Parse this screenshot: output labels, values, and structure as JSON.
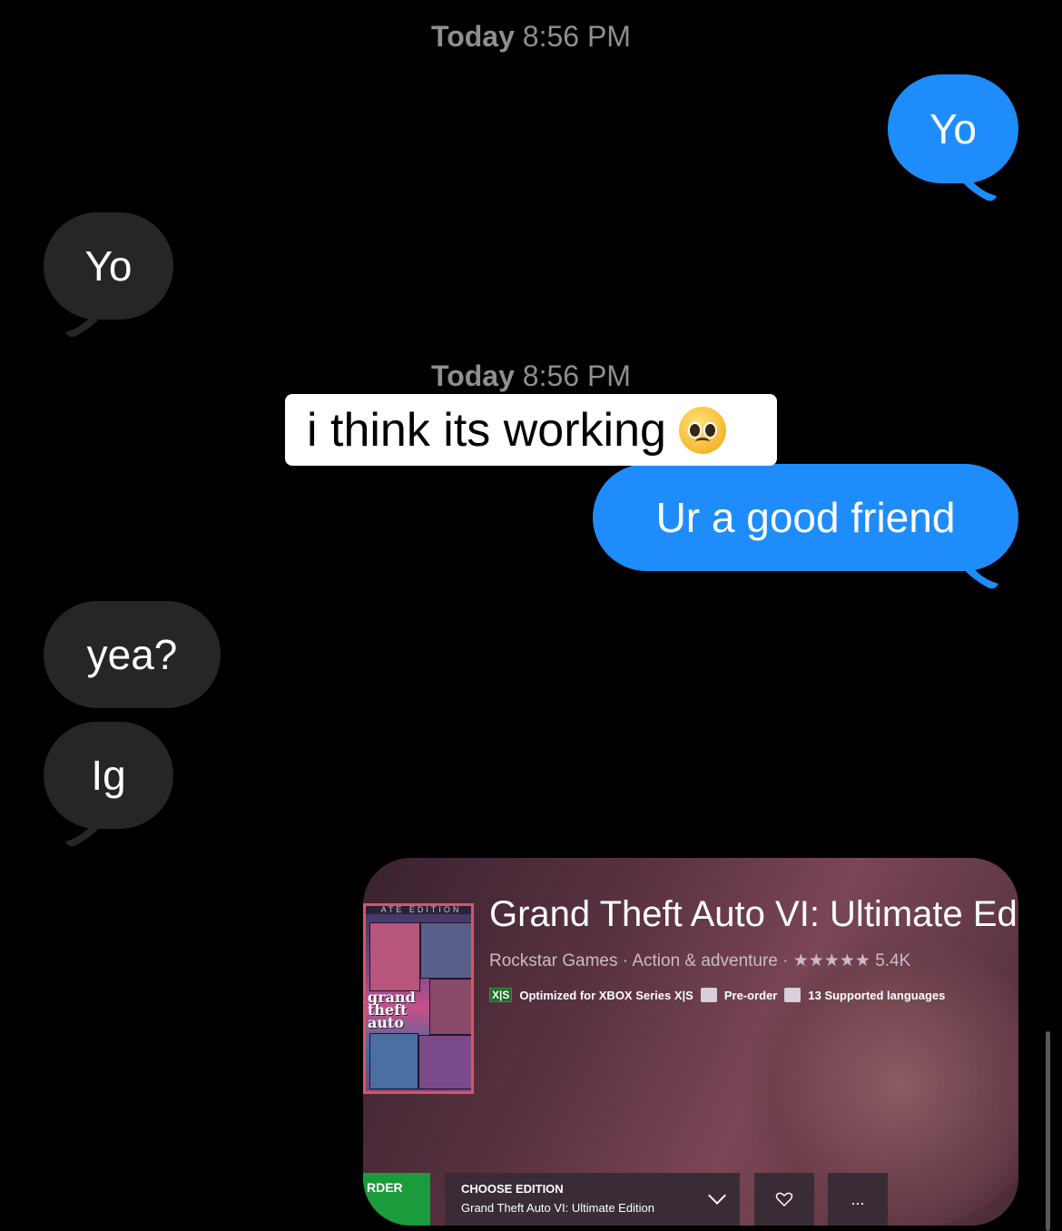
{
  "timestamps": [
    {
      "day": "Today",
      "time": "8:56 PM"
    },
    {
      "day": "Today",
      "time": "8:56 PM"
    }
  ],
  "messages": [
    {
      "direction": "outgoing",
      "text": "Yo"
    },
    {
      "direction": "incoming",
      "text": "Yo"
    },
    {
      "direction": "outgoing",
      "text": "Ur a good friend"
    },
    {
      "direction": "incoming",
      "text": "yea?"
    },
    {
      "direction": "incoming",
      "text": "Ig"
    }
  ],
  "caption": {
    "text": "i think its working",
    "emoji": "pleading-face"
  },
  "colors": {
    "background": "#000000",
    "incoming": "#262628",
    "outgoing": "#1e8dfb",
    "timestamp": "#8e8e93"
  },
  "game_card": {
    "cover_edition": "ATE EDITION",
    "cover_logo": [
      "grand",
      "theft",
      "auto"
    ],
    "title": "Grand Theft Auto VI: Ultimate Ed",
    "publisher": "Rockstar Games",
    "genre": "Action & adventure",
    "stars": "★★★★★",
    "rating_count": "5.4K",
    "badge": "X|S",
    "feature_xbox": "Optimized for XBOX Series X|S",
    "feature_preorder": "Pre-order",
    "feature_languages": "13 Supported languages",
    "order_label": "RDER",
    "choose_edition_label": "CHOOSE EDITION",
    "edition_value": "Grand Theft Auto VI: Ultimate Edition",
    "more_label": "..."
  }
}
